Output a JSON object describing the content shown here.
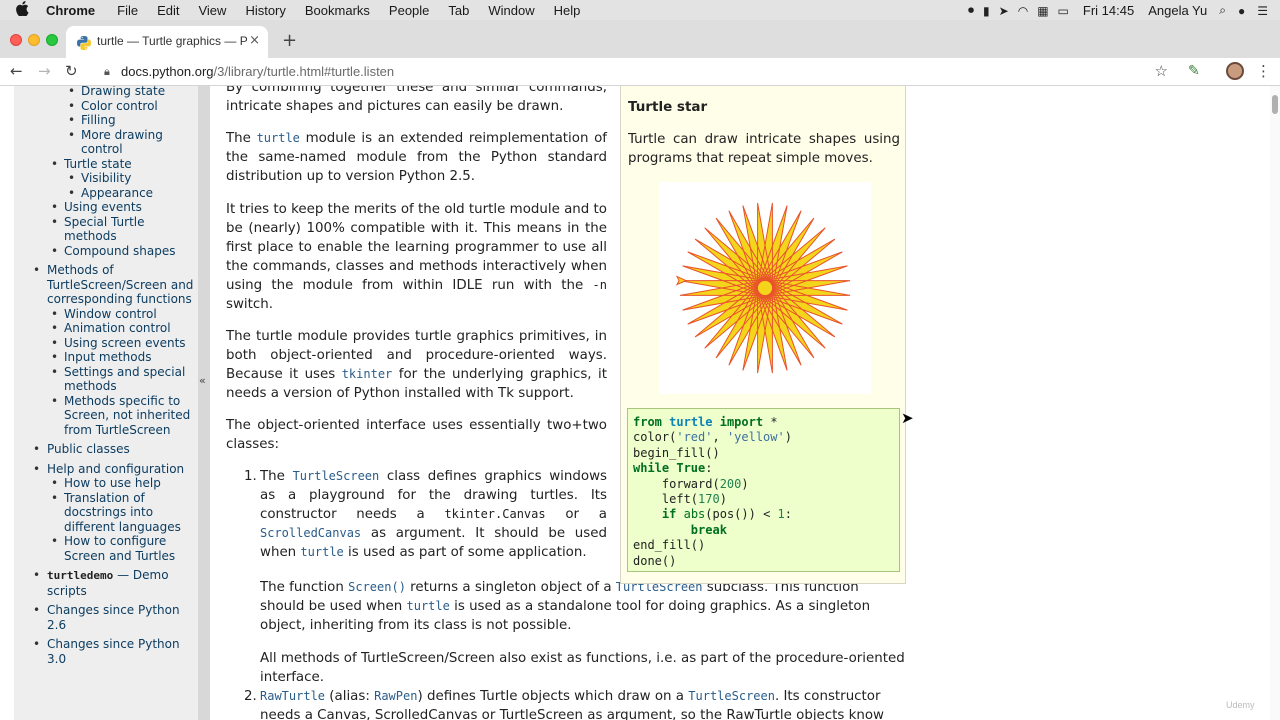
{
  "menubar": {
    "apple": "",
    "app": "Chrome",
    "items": [
      "File",
      "Edit",
      "View",
      "History",
      "Bookmarks",
      "People",
      "Tab",
      "Window",
      "Help"
    ],
    "clock": "Fri 14:45",
    "user": "Angela Yu"
  },
  "tab": {
    "title": "turtle — Turtle graphics — Python",
    "close": "×",
    "new_tab": "+"
  },
  "toolbar": {
    "url_host": "docs.python.org",
    "url_path": "/3/library/turtle.html#turtle.listen"
  },
  "sidebar": {
    "collapse": "«",
    "items": [
      {
        "label": "Drawing state",
        "level": 3
      },
      {
        "label": "Color control",
        "level": 3
      },
      {
        "label": "Filling",
        "level": 3
      },
      {
        "label": "More drawing control",
        "level": 3
      },
      {
        "label": "Turtle state",
        "level": 2
      },
      {
        "label": "Visibility",
        "level": 3
      },
      {
        "label": "Appearance",
        "level": 3
      },
      {
        "label": "Using events",
        "level": 2
      },
      {
        "label": "Special Turtle methods",
        "level": 2
      },
      {
        "label": "Compound shapes",
        "level": 2
      },
      {
        "label": "Methods of TurtleScreen/Screen and corresponding functions",
        "level": 1
      },
      {
        "label": "Window control",
        "level": 2
      },
      {
        "label": "Animation control",
        "level": 2
      },
      {
        "label": "Using screen events",
        "level": 2
      },
      {
        "label": "Input methods",
        "level": 2
      },
      {
        "label": "Settings and special methods",
        "level": 2
      },
      {
        "label": "Methods specific to Screen, not inherited from TurtleScreen",
        "level": 2
      },
      {
        "label": "Public classes",
        "level": 1
      },
      {
        "label": "Help and configuration",
        "level": 1
      },
      {
        "label": "How to use help",
        "level": 2
      },
      {
        "label": "Translation of docstrings into different languages",
        "level": 2
      },
      {
        "label": "How to configure Screen and Turtles",
        "level": 2
      },
      {
        "label": "— Demo scripts",
        "level": 1,
        "prefix": "turtledemo"
      },
      {
        "label": "Changes since Python 2.6",
        "level": 1
      },
      {
        "label": "Changes since Python 3.0",
        "level": 1
      }
    ]
  },
  "content": {
    "p0": "By combining together these and similar commands, intricate shapes and pictures can easily be drawn.",
    "p1_a": "The ",
    "p1_code": "turtle",
    "p1_b": " module is an extended reimplementation of the same-named module from the Python standard distribution up to version Python 2.5.",
    "p2_a": "It tries to keep the merits of the old turtle module and to be (nearly) 100% compatible with it. This means in the first place to enable the learning programmer to use all the commands, classes and methods interactively when using the module from within IDLE run with the ",
    "p2_code": "-n",
    "p2_b": " switch.",
    "p3_a": "The turtle module provides turtle graphics primitives, in both object-oriented and procedure-oriented ways. Because it uses ",
    "p3_code": "tkinter",
    "p3_b": " for the underlying graphics, it needs a version of Python installed with Tk support.",
    "p4": "The object-oriented interface uses essentially two+two classes:",
    "li1_num": "1.",
    "li1_a": "The ",
    "li1_c1": "TurtleScreen",
    "li1_b": " class defines graphics windows as a playground for the drawing turtles. Its constructor needs a ",
    "li1_c2": "tkinter.Canvas",
    "li1_c": " or a ",
    "li1_c3": "ScrolledCanvas",
    "li1_d": " as argument. It should be used when ",
    "li1_c4": "turtle",
    "li1_e": " is used as part of some application.",
    "li1p2_a": "The function ",
    "li1p2_c1": "Screen()",
    "li1p2_b": " returns a singleton object of a ",
    "li1p2_c2": "TurtleScreen",
    "li1p2_c": " subclass. This function should be used when ",
    "li1p2_c3": "turtle",
    "li1p2_d": " is used as a standalone tool for doing graphics. As a singleton object, inheriting from its class is not possible.",
    "li1p3": "All methods of TurtleScreen/Screen also exist as functions, i.e. as part of the procedure-oriented interface.",
    "li2_num": "2.",
    "li2_c1": "RawTurtle",
    "li2_a": " (alias: ",
    "li2_c2": "RawPen",
    "li2_b": ") defines Turtle objects which draw on a ",
    "li2_c3": "TurtleScreen",
    "li2_c": ". Its constructor needs a Canvas, ScrolledCanvas or TurtleScreen as argument, so the RawTurtle objects know"
  },
  "turtle_star": {
    "heading": "Turtle star",
    "description": "Turtle can draw intricate shapes using programs that repeat simple moves.",
    "colors": {
      "line": "#e8532a",
      "fill": "#f5d51c"
    },
    "code": {
      "l1_kw": "from",
      "l1_mod": "turtle",
      "l1_kw2": "import",
      "l1_rest": " *",
      "l2_fn": "color(",
      "l2_s1": "'red'",
      "l2_sep": ", ",
      "l2_s2": "'yellow'",
      "l2_end": ")",
      "l3": "begin_fill()",
      "l4_kw": "while",
      "l4_b": "True",
      "l4_end": ":",
      "l5": "    forward(",
      "l5_n": "200",
      "l5_end": ")",
      "l6": "    left(",
      "l6_n": "170",
      "l6_end": ")",
      "l7_kw": "if",
      "l7_b": "abs",
      "l7_a": "(pos()) < ",
      "l7_n": "1",
      "l7_end": ":",
      "l8_kw": "break",
      "l9": "end_fill()",
      "l10": "done()"
    }
  },
  "watermark": "Udemy"
}
